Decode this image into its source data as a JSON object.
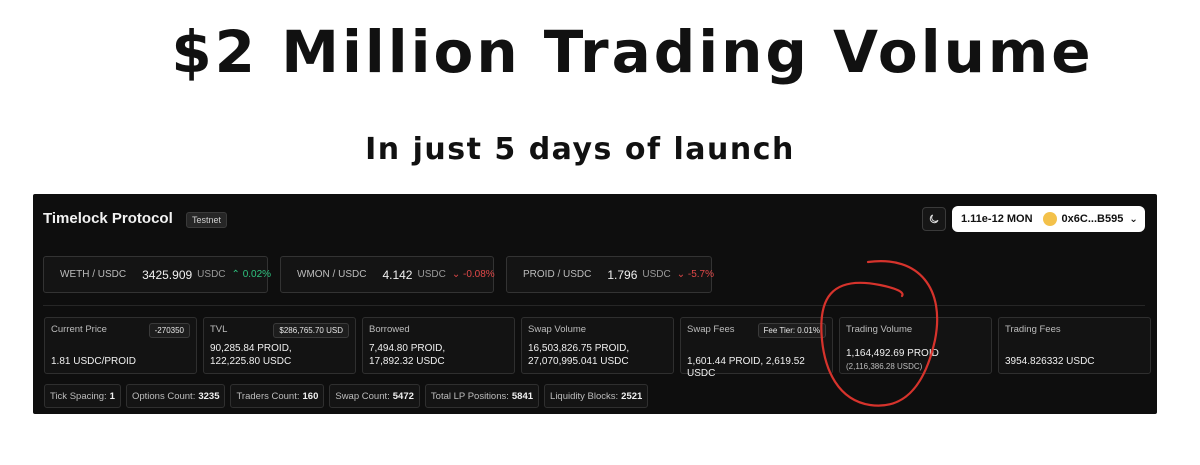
{
  "headline": "$2 Million Trading Volume",
  "subline": "In just 5 days of launch",
  "header": {
    "brand": "Timelock Protocol",
    "badge": "Testnet",
    "theme_icon": "moon-icon",
    "wallet_balance": "1.11e-12 MON",
    "wallet_address": "0x6C...B595"
  },
  "pairs": [
    {
      "symbol": "WETH / USDC",
      "price": "3425.909",
      "unit": "USDC",
      "change": "0.02%",
      "direction": "up"
    },
    {
      "symbol": "WMON / USDC",
      "price": "4.142",
      "unit": "USDC",
      "change": "-0.08%",
      "direction": "down"
    },
    {
      "symbol": "PROID / USDC",
      "price": "1.796",
      "unit": "USDC",
      "change": "-5.7%",
      "direction": "down"
    }
  ],
  "stats": {
    "current_price": {
      "label": "Current Price",
      "tag": "-270350",
      "value": "1.81 USDC/PROID"
    },
    "tvl": {
      "label": "TVL",
      "tag": "$286,765.70 USD",
      "line1": "90,285.84 PROID,",
      "line2": "122,225.80 USDC"
    },
    "borrowed": {
      "label": "Borrowed",
      "line1": "7,494.80 PROID,",
      "line2": "17,892.32 USDC"
    },
    "swap_volume": {
      "label": "Swap Volume",
      "line1": "16,503,826.75 PROID,",
      "line2": "27,070,995.041 USDC"
    },
    "swap_fees": {
      "label": "Swap Fees",
      "tag": "Fee Tier: 0.01%",
      "value": "1,601.44 PROID, 2,619.52 USDC"
    },
    "trading_volume": {
      "label": "Trading Volume",
      "value": "1,164,492.69 PROID",
      "sub": "(2,116,386.28 USDC)"
    },
    "trading_fees": {
      "label": "Trading Fees",
      "value": "3954.826332 USDC"
    }
  },
  "chips": [
    {
      "label": "Tick Spacing:",
      "value": "1"
    },
    {
      "label": "Options Count:",
      "value": "3235"
    },
    {
      "label": "Traders Count:",
      "value": "160"
    },
    {
      "label": "Swap Count:",
      "value": "5472"
    },
    {
      "label": "Total LP Positions:",
      "value": "5841"
    },
    {
      "label": "Liquidity Blocks:",
      "value": "2521"
    }
  ],
  "colors": {
    "up": "#2ec27e",
    "down": "#e04848",
    "annotation": "#d6332c"
  }
}
